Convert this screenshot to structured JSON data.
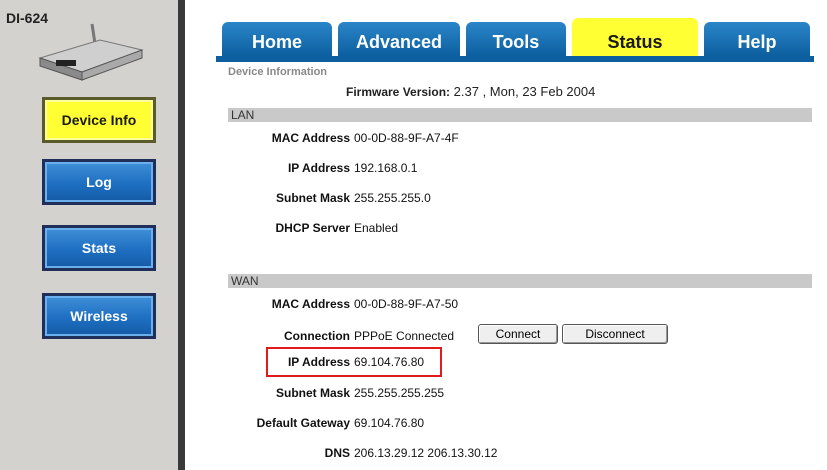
{
  "sidebar": {
    "model": "DI-624",
    "buttons": [
      {
        "label": "Device Info",
        "active": true
      },
      {
        "label": "Log",
        "active": false
      },
      {
        "label": "Stats",
        "active": false
      },
      {
        "label": "Wireless",
        "active": false
      }
    ]
  },
  "tabs": [
    "Home",
    "Advanced",
    "Tools",
    "Status",
    "Help"
  ],
  "active_tab": "Status",
  "page": {
    "heading": "Device Information",
    "firmware_label": "Firmware Version:",
    "firmware_value": "2.37 , Mon, 23 Feb 2004"
  },
  "lan": {
    "title": "LAN",
    "rows": [
      {
        "label": "MAC Address",
        "value": "00-0D-88-9F-A7-4F"
      },
      {
        "label": "IP Address",
        "value": "192.168.0.1"
      },
      {
        "label": "Subnet Mask",
        "value": "255.255.255.0"
      },
      {
        "label": "DHCP Server",
        "value": "Enabled"
      }
    ]
  },
  "wan": {
    "title": "WAN",
    "rows": [
      {
        "label": "MAC Address",
        "value": "00-0D-88-9F-A7-50"
      },
      {
        "label": "Connection",
        "value": "PPPoE Connected"
      },
      {
        "label": "IP Address",
        "value": "69.104.76.80"
      },
      {
        "label": "Subnet Mask",
        "value": "255.255.255.255"
      },
      {
        "label": "Default Gateway",
        "value": "69.104.76.80"
      },
      {
        "label": "DNS",
        "value": "206.13.29.12 206.13.30.12"
      }
    ],
    "connect_label": "Connect",
    "disconnect_label": "Disconnect"
  },
  "colors": {
    "tab_blue": "#0d5f9f",
    "active_yellow": "#ffff33",
    "highlight_red": "#e11b1b"
  }
}
